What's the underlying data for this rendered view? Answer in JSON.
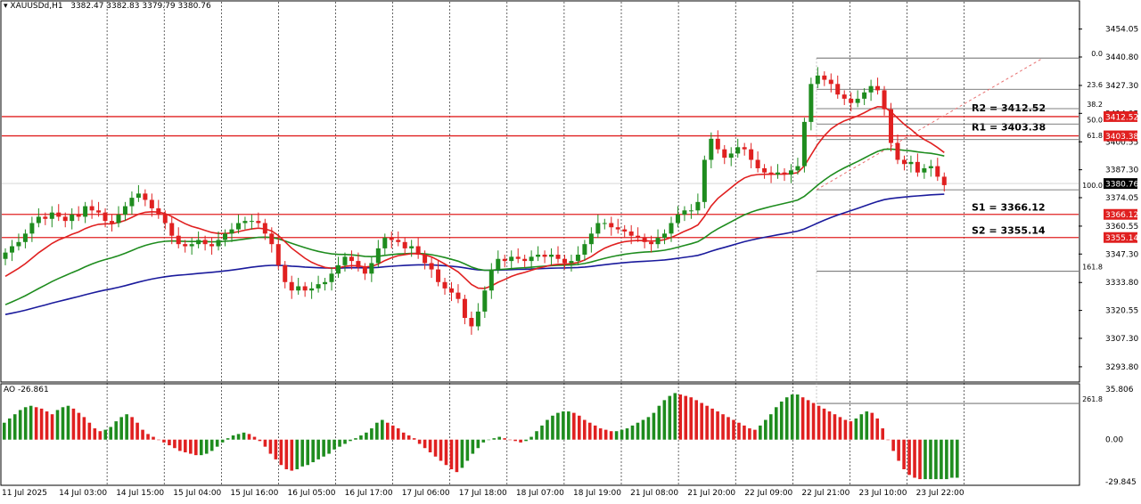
{
  "header": {
    "symbol": "XAUUSDd,H1",
    "ohlc": "3382.47 3382.83 3379.79 3380.76"
  },
  "ao_header": {
    "label": "AO -26.861"
  },
  "colors": {
    "bull": "#1e8c1e",
    "bear": "#e02020",
    "ma_fast": "#e02020",
    "ma_mid": "#1e8c1e",
    "ma_slow": "#1a1a9c",
    "level_line": "#e02020",
    "fib_line": "#555555",
    "fib_trend": "#e87070",
    "price_tag": "#e02020",
    "current_tag": "#000000"
  },
  "chart_data": [
    {
      "type": "candlestick",
      "title": "XAUUSDd,H1",
      "ylim": [
        3287,
        3467
      ],
      "y_ticks": [
        "3454.05",
        "3440.80",
        "3427.30",
        "3414.05",
        "3400.55",
        "3387.30",
        "3374.05",
        "3360.55",
        "3347.30",
        "3333.80",
        "3320.55",
        "3307.30",
        "3293.80"
      ],
      "x_ticks": [
        "11 Jul 2025",
        "14 Jul 03:00",
        "14 Jul 15:00",
        "15 Jul 04:00",
        "15 Jul 16:00",
        "16 Jul 05:00",
        "16 Jul 17:00",
        "17 Jul 06:00",
        "17 Jul 18:00",
        "18 Jul 07:00",
        "18 Jul 19:00",
        "21 Jul 08:00",
        "21 Jul 20:00",
        "22 Jul 09:00",
        "22 Jul 21:00",
        "23 Jul 10:00",
        "23 Jul 22:00"
      ],
      "current_price": "3380.76",
      "price_tags": [
        "3412.52",
        "3403.38",
        "3366.12",
        "3355.14"
      ],
      "levels": [
        {
          "label": "R2 = 3412.52",
          "value": 3412.52
        },
        {
          "label": "R1 = 3403.38",
          "value": 3403.38
        },
        {
          "label": "S1 = 3366.12",
          "value": 3366.12
        },
        {
          "label": "S2 = 3355.14",
          "value": 3355.14
        }
      ],
      "fib_levels": [
        {
          "label": "0.0",
          "value": 3440.3
        },
        {
          "label": "23.6",
          "value": 3425.5
        },
        {
          "label": "38.2",
          "value": 3416.3
        },
        {
          "label": "50.0",
          "value": 3409.0
        },
        {
          "label": "61.8",
          "value": 3401.6
        },
        {
          "label": "100.0",
          "value": 3377.8
        },
        {
          "label": "161.8",
          "value": 3339.1
        },
        {
          "label": "261.8",
          "value": 3276.4
        }
      ],
      "closes": [
        3348,
        3351,
        3353,
        3357,
        3362,
        3365,
        3364,
        3367,
        3365,
        3363,
        3366,
        3365,
        3370,
        3368,
        3367,
        3363,
        3362,
        3366,
        3370,
        3374,
        3376,
        3373,
        3369,
        3366,
        3362,
        3356,
        3352,
        3351,
        3352,
        3354,
        3352,
        3351,
        3354,
        3357,
        3359,
        3362,
        3363,
        3363,
        3362,
        3357,
        3352,
        3342,
        3334,
        3330,
        3332,
        3330,
        3331,
        3333,
        3334,
        3338,
        3342,
        3346,
        3344,
        3341,
        3338,
        3343,
        3350,
        3355,
        3354,
        3353,
        3350,
        3351,
        3347,
        3343,
        3340,
        3334,
        3331,
        3329,
        3326,
        3317,
        3313,
        3320,
        3330,
        3340,
        3345,
        3344,
        3346,
        3345,
        3344,
        3346,
        3347,
        3346,
        3347,
        3345,
        3343,
        3344,
        3347,
        3352,
        3357,
        3362,
        3362,
        3360,
        3359,
        3358,
        3356,
        3355,
        3353,
        3352,
        3355,
        3357,
        3362,
        3366,
        3368,
        3368,
        3372,
        3392,
        3402,
        3397,
        3393,
        3395,
        3398,
        3397,
        3392,
        3388,
        3386,
        3385,
        3386,
        3385,
        3387,
        3389,
        3410,
        3428,
        3432,
        3430,
        3428,
        3423,
        3421,
        3419,
        3421,
        3424,
        3427,
        3425,
        3416,
        3400,
        3392,
        3390,
        3391,
        3386,
        3388,
        3389,
        3384,
        3380
      ],
      "ao_values": [
        12,
        15,
        18,
        21,
        23,
        24,
        23,
        22,
        20,
        18,
        21,
        23,
        24,
        22,
        19,
        16,
        12,
        8,
        6,
        7,
        9,
        13,
        16,
        18,
        16,
        12,
        7,
        4,
        2,
        0,
        -2,
        -4,
        -6,
        -8,
        -9,
        -10,
        -11,
        -11,
        -10,
        -8,
        -5,
        -2,
        1,
        3,
        4,
        5,
        4,
        2,
        -1,
        -5,
        -10,
        -14,
        -18,
        -21,
        -22,
        -21,
        -19,
        -18,
        -16,
        -14,
        -12,
        -10,
        -7,
        -5,
        -3,
        -1,
        1,
        3,
        5,
        8,
        12,
        14,
        12,
        10,
        8,
        5,
        3,
        1,
        -3,
        -6,
        -9,
        -12,
        -15,
        -18,
        -21,
        -23,
        -20,
        -15,
        -10,
        -6,
        -2,
        0,
        1,
        2,
        1,
        0,
        -1,
        -2,
        -1,
        2,
        6,
        10,
        14,
        17,
        19,
        20,
        20,
        19,
        17,
        14,
        12,
        10,
        8,
        7,
        6,
        6,
        7,
        8,
        10,
        12,
        14,
        16,
        19,
        24,
        28,
        31,
        33,
        32,
        31,
        30,
        28,
        26,
        24,
        22,
        20,
        18,
        16,
        14,
        12,
        10,
        8,
        7,
        10,
        14,
        18,
        23,
        27,
        30,
        32,
        32,
        30,
        28,
        26,
        24,
        22,
        20,
        18,
        16,
        14,
        13,
        15,
        18,
        20,
        19,
        15,
        8,
        0,
        -8,
        -15,
        -21,
        -25,
        -27,
        -28,
        -28,
        -28,
        -28,
        -28,
        -28,
        -27,
        -27
      ],
      "ao_ticks": [
        "35.806",
        "0.00",
        "-29.845"
      ],
      "ao_ylim": [
        -29.845,
        35.806
      ]
    }
  ]
}
